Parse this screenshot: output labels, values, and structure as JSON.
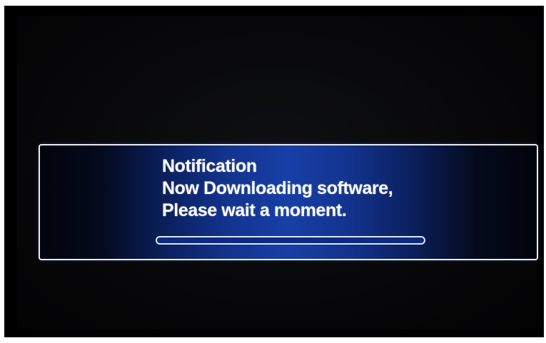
{
  "notification": {
    "title": "Notification",
    "line1": "Now Downloading software,",
    "line2": "Please wait a moment.",
    "progress_fraction": 0
  },
  "colors": {
    "dialog_center": "#173fa6",
    "dialog_edge": "#02040b",
    "border": "#e7ecf7",
    "text": "#ffffff"
  }
}
